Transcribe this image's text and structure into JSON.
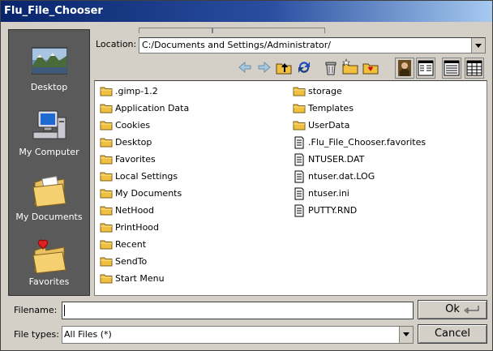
{
  "window": {
    "title": "Flu_File_Chooser"
  },
  "sidebar": {
    "items": [
      {
        "label": "Desktop",
        "icon": "desktop-icon"
      },
      {
        "label": "My Computer",
        "icon": "computer-icon"
      },
      {
        "label": "My Documents",
        "icon": "documents-folder-icon"
      },
      {
        "label": "Favorites",
        "icon": "favorites-folder-icon"
      }
    ]
  },
  "location": {
    "label": "Location:",
    "value": "C:/Documents and Settings/Administrator/"
  },
  "toolbar": {
    "icons": [
      "back-arrow-icon",
      "forward-arrow-icon",
      "up-folder-icon",
      "refresh-icon",
      "trash-icon",
      "new-folder-icon",
      "add-favorite-icon",
      "preview-icon",
      "list-view-icon",
      "wide-list-view-icon",
      "details-view-icon"
    ]
  },
  "files": {
    "column1": [
      {
        "name": ".gimp-1.2",
        "type": "folder"
      },
      {
        "name": "Application Data",
        "type": "folder"
      },
      {
        "name": "Cookies",
        "type": "folder"
      },
      {
        "name": "Desktop",
        "type": "folder"
      },
      {
        "name": "Favorites",
        "type": "folder"
      },
      {
        "name": "Local Settings",
        "type": "folder"
      },
      {
        "name": "My Documents",
        "type": "folder"
      },
      {
        "name": "NetHood",
        "type": "folder"
      },
      {
        "name": "PrintHood",
        "type": "folder"
      },
      {
        "name": "Recent",
        "type": "folder"
      },
      {
        "name": "SendTo",
        "type": "folder"
      },
      {
        "name": "Start Menu",
        "type": "folder"
      }
    ],
    "column2": [
      {
        "name": "storage",
        "type": "folder"
      },
      {
        "name": "Templates",
        "type": "folder"
      },
      {
        "name": "UserData",
        "type": "folder"
      },
      {
        "name": ".Flu_File_Chooser.favorites",
        "type": "file"
      },
      {
        "name": "NTUSER.DAT",
        "type": "file"
      },
      {
        "name": "ntuser.dat.LOG",
        "type": "file"
      },
      {
        "name": "ntuser.ini",
        "type": "file"
      },
      {
        "name": "PUTTY.RND",
        "type": "file"
      }
    ]
  },
  "filename": {
    "label": "Filename:",
    "value": ""
  },
  "filetypes": {
    "label": "File types:",
    "value": "All Files (*)"
  },
  "buttons": {
    "ok": "Ok",
    "cancel": "Cancel"
  },
  "colors": {
    "titlebar_start": "#08246b",
    "titlebar_end": "#a6caf0",
    "sidebar": "#5a5a5a",
    "folder": "#f0c040"
  }
}
